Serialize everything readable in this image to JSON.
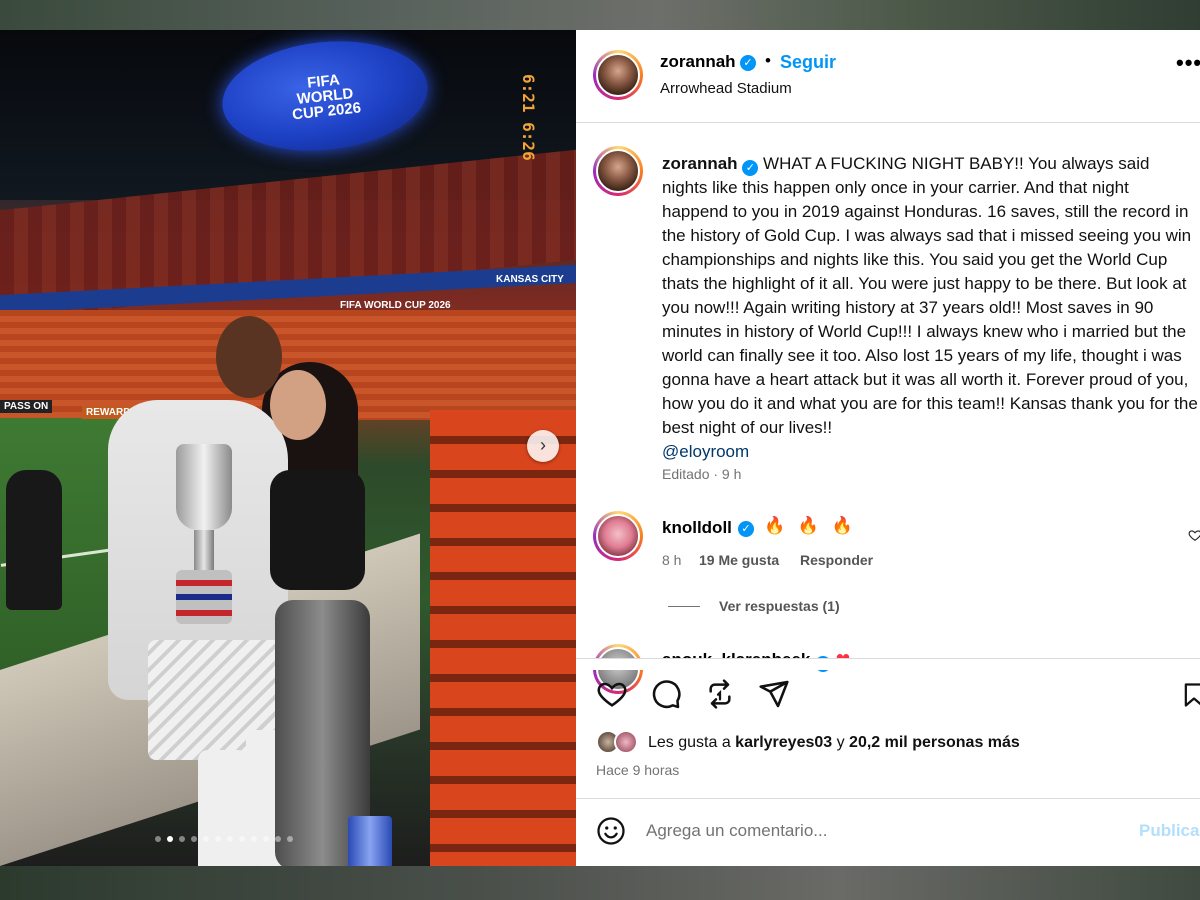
{
  "photo": {
    "jumbotron_lines": [
      "FIFA",
      "WORLD",
      "CUP 2026"
    ],
    "board_left": "FIFA WORLD CUP 2026",
    "board_right": "KANSAS CITY",
    "scoreboard": "6:21 6:26",
    "pitch_board_1": "PASS ON",
    "pitch_board_2": "REWARDS FIFA",
    "carousel_next_icon": "chevron-right-icon",
    "dot_count": 12,
    "active_dot": 1
  },
  "header": {
    "username": "zorannah",
    "verified_icon": "verified-badge-icon",
    "separator": "•",
    "follow_label": "Seguir",
    "location": "Arrowhead Stadium",
    "more_icon": "more-options-icon",
    "more_label": "•••"
  },
  "caption": {
    "username": "zorannah",
    "text": "WHAT A FUCKING NIGHT BABY!! You always said nights like this happen only once in your carrier. And that night happend to you in 2019 against Honduras. 16 saves, still the record in the history of Gold Cup. I was always sad that i missed seeing you win championships and nights like this. You said you get the World Cup thats the highlight of it all. You were just happy to be there. But look at you now!!! Again writing history at 37 years old!! Most saves in 90 minutes in history of World Cup!!! I always knew who i married but the world can finally see it too. Also lost 15 years of my life, thought i was gonna have a heart attack but it was all worth it. Forever proud of you, how you do it and what you are for this team!! Kansas thank you for the best night of our lives!!",
    "mention": "@eloyroom",
    "meta": "Editado · 9 h"
  },
  "comments": [
    {
      "username": "knolldoll",
      "text": "🔥 🔥 🔥",
      "time": "8 h",
      "likes": "19 Me gusta",
      "reply_label": "Responder",
      "view_replies": "Ver respuestas (1)"
    },
    {
      "username": "anouk_klarenbeek",
      "text": "❤"
    }
  ],
  "actions": {
    "like_icon": "heart-icon",
    "comment_icon": "comment-icon",
    "repost_icon": "repost-icon",
    "share_icon": "send-icon",
    "save_icon": "bookmark-icon"
  },
  "likes": {
    "prefix": "Les gusta a ",
    "user": "karlyreyes03",
    "middle": " y ",
    "count": "20,2 mil personas más",
    "posted": "Hace 9 horas"
  },
  "comment_box": {
    "emoji_icon": "emoji-icon",
    "placeholder": "Agrega un comentario...",
    "publish_label": "Publicar"
  },
  "colors": {
    "accent": "#0095f6",
    "publish_disabled": "#b2dffc",
    "muted": "#737373"
  }
}
